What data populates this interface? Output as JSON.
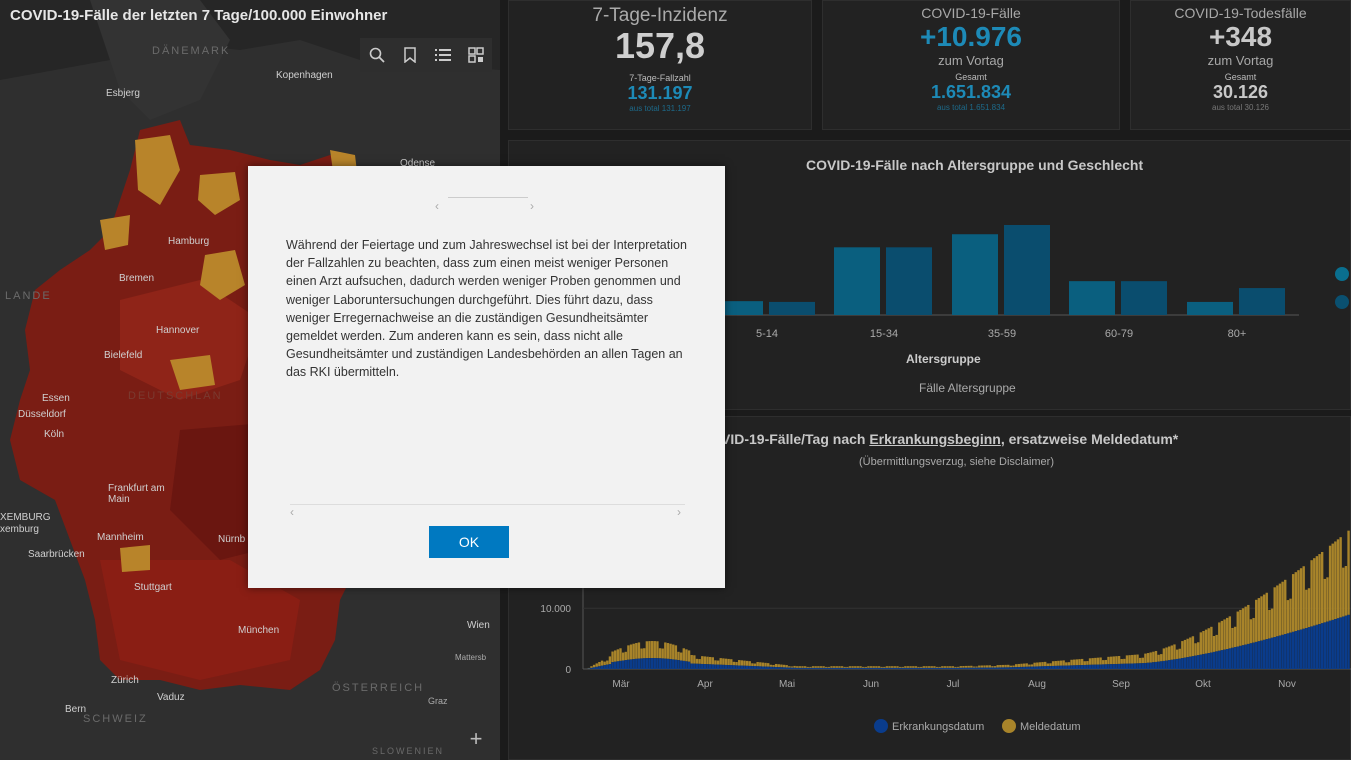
{
  "map": {
    "title": "COVID-19-Fälle der letzten 7 Tage/100.000 Einwohner",
    "toolbar_icons": [
      "search-icon",
      "bookmark-icon",
      "legend-list-icon",
      "qr-grid-icon"
    ],
    "zoom_in_label": "+",
    "places": [
      {
        "id": "daenemark",
        "label": "DÄNEMARK",
        "kind": "country"
      },
      {
        "id": "kopenhagen",
        "label": "Kopenhagen",
        "kind": "city"
      },
      {
        "id": "esbjerg",
        "label": "Esbjerg",
        "kind": "city"
      },
      {
        "id": "hamburg",
        "label": "Hamburg",
        "kind": "city"
      },
      {
        "id": "bremen",
        "label": "Bremen",
        "kind": "city"
      },
      {
        "id": "lande",
        "label": "LANDE",
        "kind": "country"
      },
      {
        "id": "hannover",
        "label": "Hannover",
        "kind": "city"
      },
      {
        "id": "bielefeld",
        "label": "Bielefeld",
        "kind": "city"
      },
      {
        "id": "deutschland",
        "label": "DEUTSCHLAN",
        "kind": "country"
      },
      {
        "id": "essen",
        "label": "Essen",
        "kind": "city"
      },
      {
        "id": "duesseldorf",
        "label": "Düsseldorf",
        "kind": "city"
      },
      {
        "id": "koeln",
        "label": "Köln",
        "kind": "city"
      },
      {
        "id": "frankfurt",
        "label": "Frankfurt am Main",
        "kind": "city"
      },
      {
        "id": "luxemburg1",
        "label": "XEMBURG",
        "kind": "city"
      },
      {
        "id": "luxemburg2",
        "label": "xemburg",
        "kind": "city"
      },
      {
        "id": "mannheim",
        "label": "Mannheim",
        "kind": "city"
      },
      {
        "id": "nuernberg",
        "label": "Nürnb",
        "kind": "city"
      },
      {
        "id": "saarbruecken",
        "label": "Saarbrücken",
        "kind": "city"
      },
      {
        "id": "stuttgart",
        "label": "Stuttgart",
        "kind": "city"
      },
      {
        "id": "muenchen",
        "label": "München",
        "kind": "city"
      },
      {
        "id": "wien",
        "label": "Wien",
        "kind": "city"
      },
      {
        "id": "mattersburg",
        "label": "Mattersb",
        "kind": "city"
      },
      {
        "id": "zuerich",
        "label": "Zürich",
        "kind": "city"
      },
      {
        "id": "vaduz",
        "label": "Vaduz",
        "kind": "city"
      },
      {
        "id": "oesterreich",
        "label": "ÖSTERREICH",
        "kind": "country"
      },
      {
        "id": "bern",
        "label": "Bern",
        "kind": "city"
      },
      {
        "id": "schweiz",
        "label": "SCHWEIZ",
        "kind": "country"
      },
      {
        "id": "graz",
        "label": "Graz",
        "kind": "city"
      },
      {
        "id": "slowenien",
        "label": "SLOWENIEN",
        "kind": "country"
      },
      {
        "id": "odense",
        "label": "Odense",
        "kind": "city"
      }
    ]
  },
  "kpis": {
    "incidence": {
      "title": "7-Tage-Inzidenz",
      "value": "157,8",
      "sub_label": "7-Tage-Fallzahl",
      "sub_value": "131.197",
      "tiny": "aus total 131.197",
      "value_color": "#cfcfcf",
      "accent": "#1d8ab7"
    },
    "cases": {
      "title": "COVID-19-Fälle",
      "value": "+10.976",
      "sub": "zum Vortag",
      "sub_label": "Gesamt",
      "sub_value": "1.651.834",
      "tiny": "aus total 1.651.834",
      "value_color": "#1d8ab7"
    },
    "deaths": {
      "title": "COVID-19-Todesfälle",
      "value": "+348",
      "sub": "zum Vortag",
      "sub_label": "Gesamt",
      "sub_value": "30.126",
      "tiny": "aus total 30.126",
      "value_color": "#c8c8c8"
    }
  },
  "age_chart": {
    "title": "COVID-19-Fälle nach Altersgruppe und Geschlecht",
    "xlabel": "Altersgruppe",
    "footer": "Fälle Altersgruppe"
  },
  "daily_chart": {
    "title_prefix": "VID-19-Fälle/Tag nach ",
    "title_link": "Erkrankungsbeginn",
    "title_suffix": ", ersatzweise Meldedatum*",
    "subtitle": "(Übermittlungsverzug, siehe Disclaimer)"
  },
  "chart_data": [
    {
      "type": "bar",
      "title": "COVID-19-Fälle nach Altersgruppe und Geschlecht",
      "categories": [
        "5-14",
        "15-34",
        "35-59",
        "60-79",
        "80+"
      ],
      "series": [
        {
          "values": [
            18,
            88,
            105,
            44,
            17
          ]
        },
        {
          "values": [
            17,
            88,
            117,
            44,
            35
          ]
        }
      ],
      "xlabel": "Altersgruppe",
      "ylim": [
        0,
        130
      ],
      "colors": [
        "#0a5f7f",
        "#0a4d6e"
      ]
    },
    {
      "type": "bar",
      "categories": [
        "Mär",
        "Apr",
        "Mai",
        "Jun",
        "Jul",
        "Aug",
        "Sep",
        "Okt",
        "Nov"
      ],
      "ytick_labels": [
        "0",
        "10.000"
      ],
      "ylim": [
        0,
        25000
      ],
      "series": [
        {
          "name": "Erkrankungsdatum",
          "color": "#0a3c8c"
        },
        {
          "name": "Meldedatum",
          "color": "#a8842a"
        }
      ],
      "legend": "bottom"
    }
  ]
}
